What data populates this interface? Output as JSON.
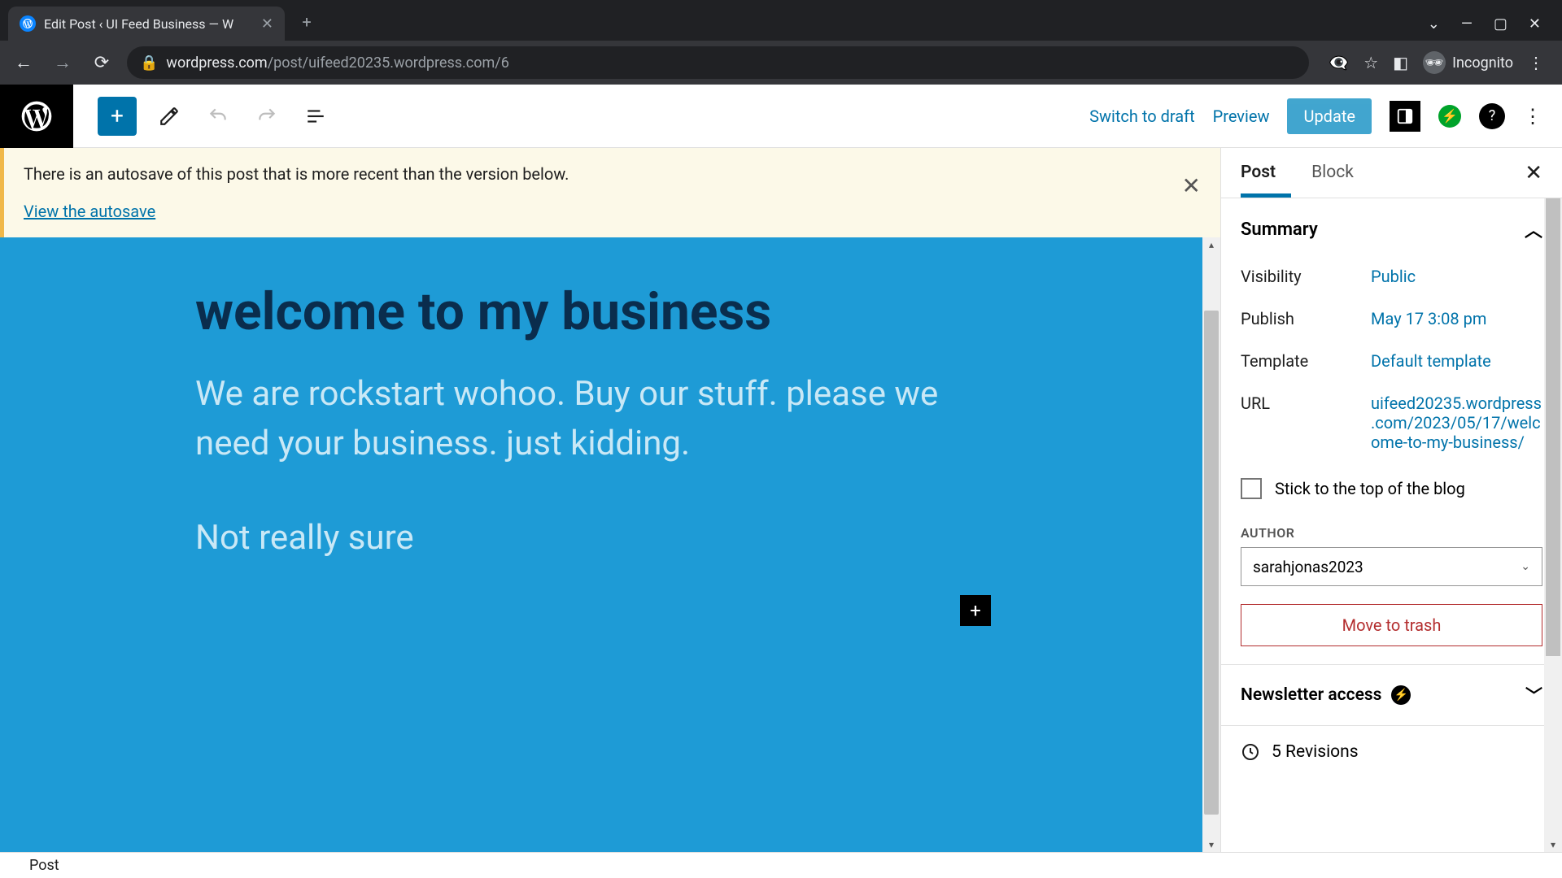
{
  "browser": {
    "tab_title": "Edit Post ‹ UI Feed Business — W",
    "url_domain": "wordpress.com",
    "url_path": "/post/uifeed20235.wordpress.com/6",
    "incognito_label": "Incognito"
  },
  "topbar": {
    "switch_to_draft": "Switch to draft",
    "preview": "Preview",
    "update": "Update"
  },
  "notice": {
    "text": "There is an autosave of this post that is more recent than the version below.",
    "link": "View the autosave"
  },
  "post": {
    "title": "welcome to my business",
    "paragraph1": "We are rockstart wohoo. Buy our stuff. please we need your business. just kidding.",
    "paragraph2": "Not really sure"
  },
  "sidebar": {
    "tabs": {
      "post": "Post",
      "block": "Block"
    },
    "summary_label": "Summary",
    "visibility_label": "Visibility",
    "visibility_value": "Public",
    "publish_label": "Publish",
    "publish_value": "May 17 3:08 pm",
    "template_label": "Template",
    "template_value": "Default template",
    "url_label": "URL",
    "url_value": "uifeed20235.wordpress.com/2023/05/17/welcome-to-my-business/",
    "sticky_label": "Stick to the top of the blog",
    "author_label": "Author",
    "author_value": "sarahjonas2023",
    "trash_label": "Move to trash",
    "newsletter_label": "Newsletter access",
    "revisions_label": "5 Revisions"
  },
  "statusbar": {
    "breadcrumb": "Post"
  }
}
